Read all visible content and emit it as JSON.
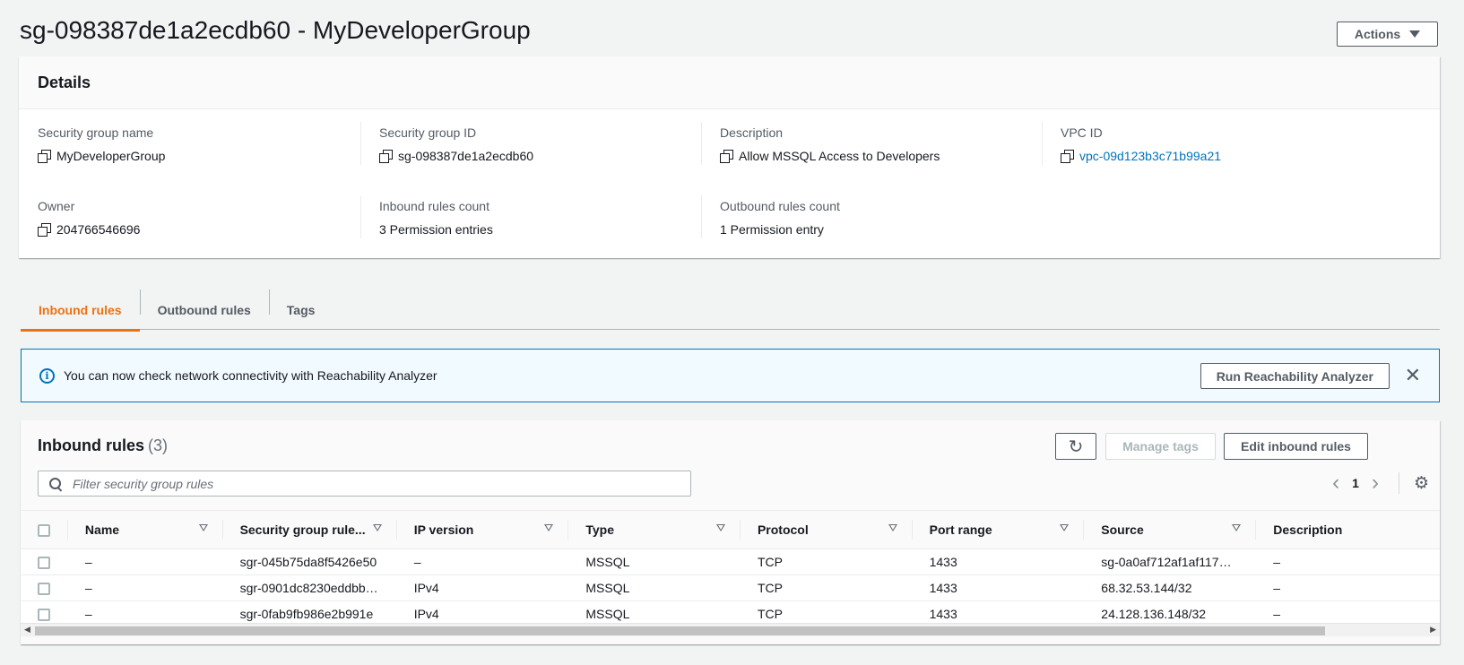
{
  "page": {
    "title": "sg-098387de1a2ecdb60 - MyDeveloperGroup",
    "actions_label": "Actions"
  },
  "details": {
    "heading": "Details",
    "fields": [
      {
        "label": "Security group name",
        "value": "MyDeveloperGroup",
        "copy": true,
        "link": false
      },
      {
        "label": "Security group ID",
        "value": "sg-098387de1a2ecdb60",
        "copy": true,
        "link": false
      },
      {
        "label": "Description",
        "value": "Allow MSSQL Access to Developers",
        "copy": true,
        "link": false
      },
      {
        "label": "VPC ID",
        "value": "vpc-09d123b3c71b99a21",
        "copy": true,
        "link": true
      },
      {
        "label": "Owner",
        "value": "204766546696",
        "copy": true,
        "link": false
      },
      {
        "label": "Inbound rules count",
        "value": "3 Permission entries",
        "copy": false,
        "link": false
      },
      {
        "label": "Outbound rules count",
        "value": "1 Permission entry",
        "copy": false,
        "link": false
      }
    ]
  },
  "tabs": [
    {
      "label": "Inbound rules",
      "active": true
    },
    {
      "label": "Outbound rules",
      "active": false
    },
    {
      "label": "Tags",
      "active": false
    }
  ],
  "banner": {
    "text": "You can now check network connectivity with Reachability Analyzer",
    "button_label": "Run Reachability Analyzer"
  },
  "rules": {
    "title": "Inbound rules",
    "count": "(3)",
    "manage_tags_label": "Manage tags",
    "edit_label": "Edit inbound rules",
    "filter_placeholder": "Filter security group rules",
    "page_number": "1",
    "columns": [
      "Name",
      "Security group rule...",
      "IP version",
      "Type",
      "Protocol",
      "Port range",
      "Source",
      "Description"
    ],
    "rows": [
      [
        "–",
        "sgr-045b75da8f5426e50",
        "–",
        "MSSQL",
        "TCP",
        "1433",
        "sg-0a0af712af1af117…",
        "–"
      ],
      [
        "–",
        "sgr-0901dc8230eddbb…",
        "IPv4",
        "MSSQL",
        "TCP",
        "1433",
        "68.32.53.144/32",
        "–"
      ],
      [
        "–",
        "sgr-0fab9fb986e2b991e",
        "IPv4",
        "MSSQL",
        "TCP",
        "1433",
        "24.128.136.148/32",
        "–"
      ]
    ]
  },
  "colors": {
    "accent": "#ec7211",
    "link": "#0073bb",
    "info_bg": "#f1faff"
  }
}
